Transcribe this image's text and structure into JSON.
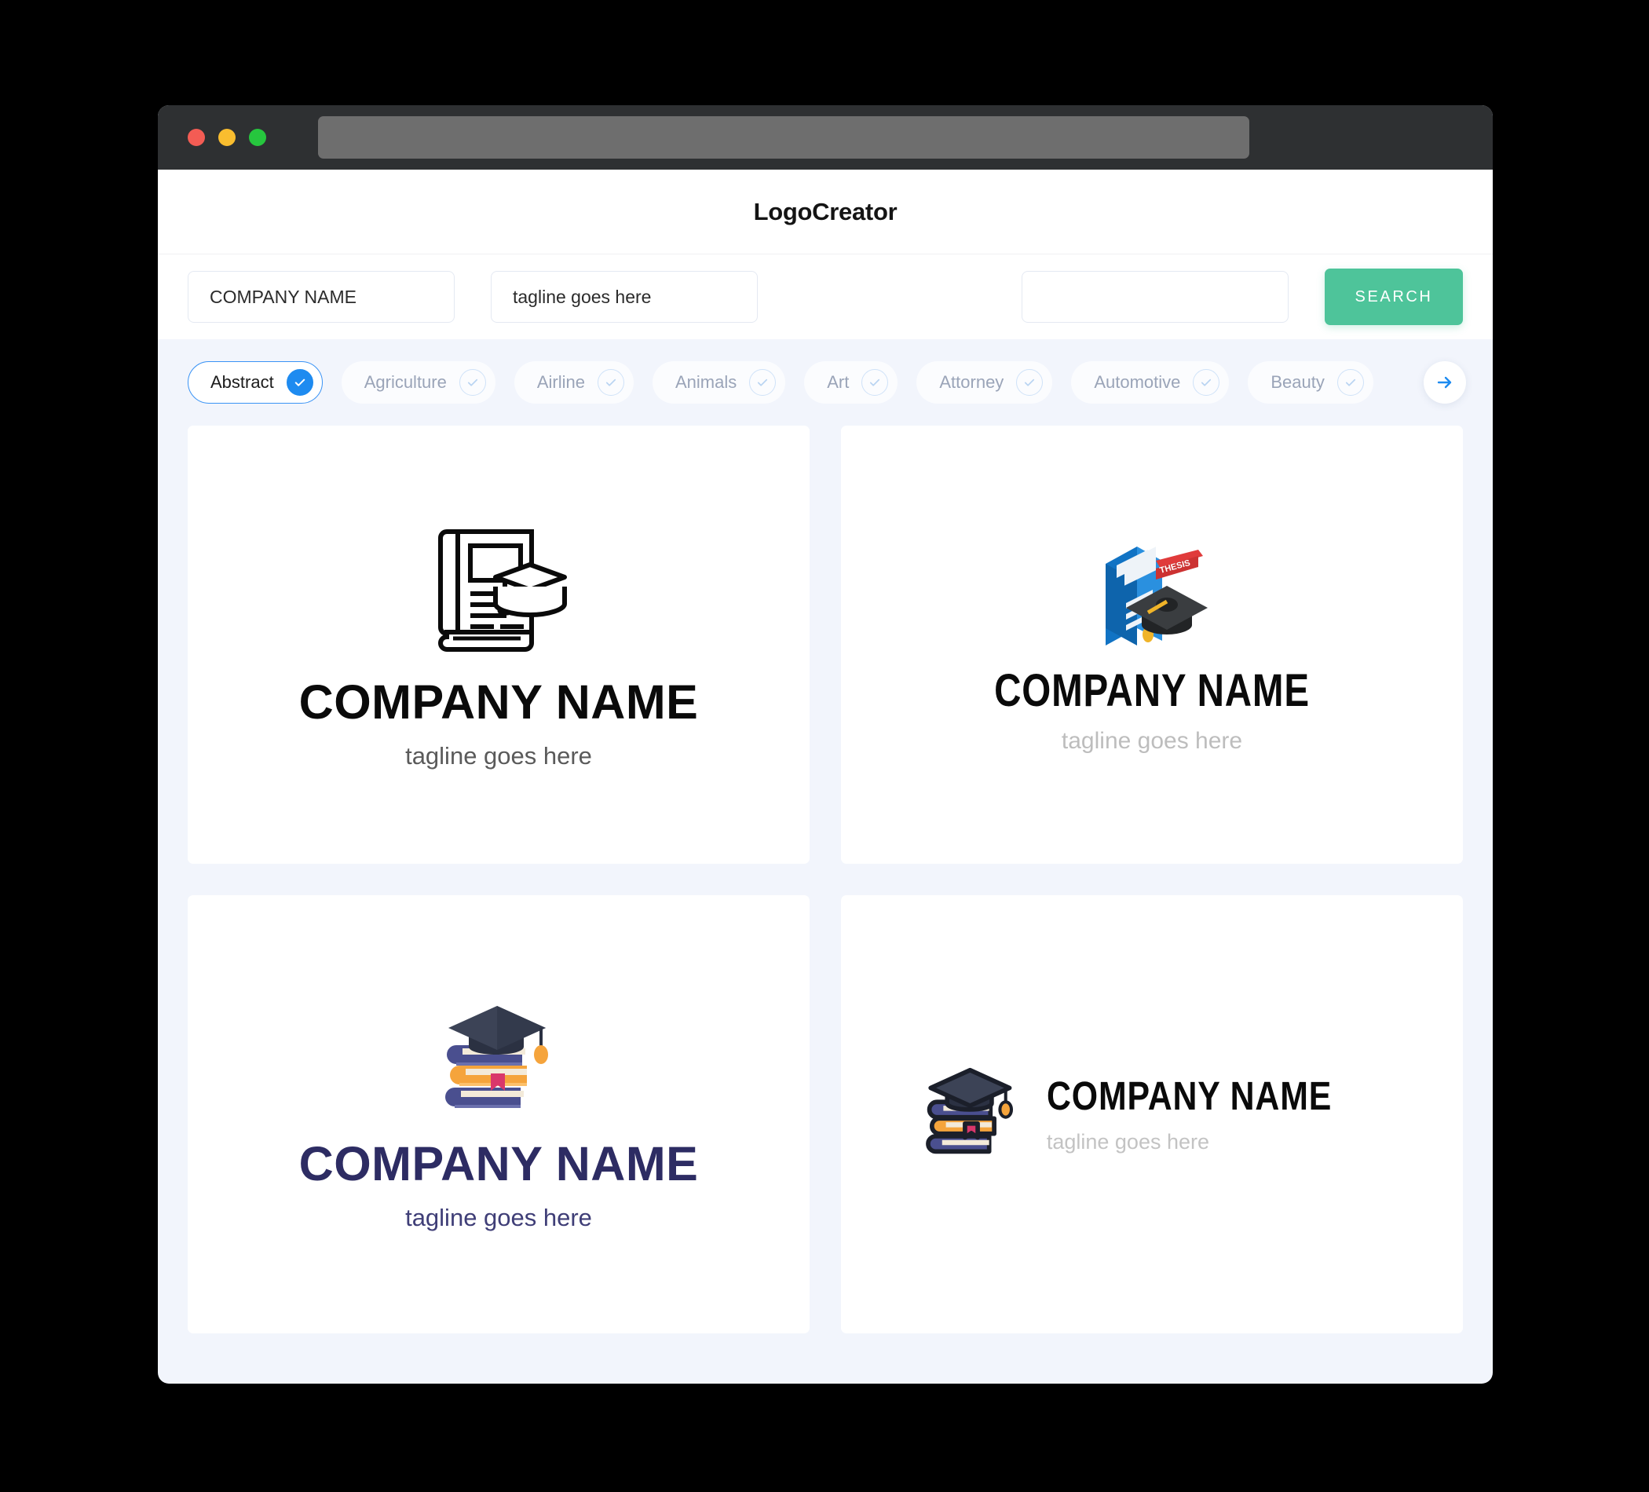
{
  "window": {
    "traffic_lights": [
      {
        "name": "close",
        "color": "#f35c54"
      },
      {
        "name": "minimize",
        "color": "#f9bd2f"
      },
      {
        "name": "maximize",
        "color": "#26c63e"
      }
    ],
    "url_value": ""
  },
  "header": {
    "title": "LogoCreator"
  },
  "search": {
    "company_name_value": "COMPANY NAME",
    "company_name_placeholder": "COMPANY NAME",
    "tagline_value": "tagline goes here",
    "tagline_placeholder": "tagline goes here",
    "keyword_value": "",
    "keyword_placeholder": "",
    "search_label": "SEARCH",
    "accent_color": "#4ec49a"
  },
  "categories": {
    "selected": "Abstract",
    "selected_color": "#1e8bf0",
    "next_icon": "arrow-right-icon",
    "items": [
      {
        "label": "Abstract",
        "selected": true
      },
      {
        "label": "Agriculture",
        "selected": false
      },
      {
        "label": "Airline",
        "selected": false
      },
      {
        "label": "Animals",
        "selected": false
      },
      {
        "label": "Art",
        "selected": false
      },
      {
        "label": "Attorney",
        "selected": false
      },
      {
        "label": "Automotive",
        "selected": false
      },
      {
        "label": "Beauty",
        "selected": false
      }
    ]
  },
  "results": {
    "cards": [
      {
        "id": "card-1",
        "icon": "book-with-graduation-cap-lineart-icon",
        "name": "COMPANY NAME",
        "tagline": "tagline goes here",
        "name_color": "#0a0a0a",
        "tagline_color": "#5a5a5a",
        "layout": "stacked"
      },
      {
        "id": "card-2",
        "icon": "isometric-thesis-book-graduation-cap-icon",
        "badge_text": "THESIS",
        "name": "COMPANY NAME",
        "tagline": "tagline goes here",
        "name_color": "#0a0a0a",
        "tagline_color": "#bdbdbd",
        "layout": "stacked"
      },
      {
        "id": "card-3",
        "icon": "book-stack-graduation-cap-icon",
        "name": "COMPANY NAME",
        "tagline": "tagline goes here",
        "name_color": "#2d2c63",
        "tagline_color": "#3f3e77",
        "layout": "stacked"
      },
      {
        "id": "card-4",
        "icon": "book-stack-graduation-cap-outlined-icon",
        "name": "COMPANY NAME",
        "tagline": "tagline goes here",
        "name_color": "#0a0a0a",
        "tagline_color": "#c3c3c3",
        "layout": "horizontal"
      }
    ]
  }
}
